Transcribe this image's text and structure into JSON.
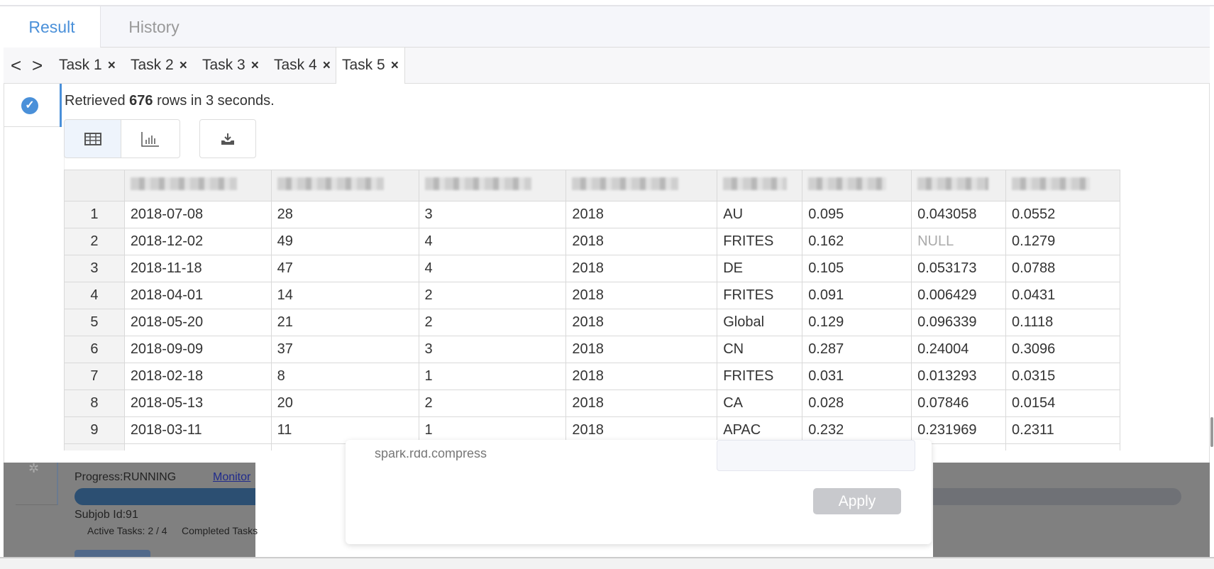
{
  "tabs": {
    "result": "Result",
    "history": "History"
  },
  "task_nav": {
    "prev": "<",
    "next": ">"
  },
  "task_tabs": [
    {
      "label": "Task 1",
      "close": "×"
    },
    {
      "label": "Task 2",
      "close": "×"
    },
    {
      "label": "Task 3",
      "close": "×"
    },
    {
      "label": "Task 4",
      "close": "×"
    },
    {
      "label": "Task 5",
      "close": "×",
      "active": true
    }
  ],
  "status": {
    "prefix": "Retrieved ",
    "count": "676",
    "suffix": " rows in 3 seconds."
  },
  "toolbar": {
    "table_icon": "table-icon",
    "chart_icon": "bar-chart-icon",
    "download_icon": "download-icon"
  },
  "table": {
    "rows": [
      [
        "1",
        "2018-07-08",
        "28",
        "3",
        "2018",
        "AU",
        "0.095",
        "0.043058",
        "0.0552"
      ],
      [
        "2",
        "2018-12-02",
        "49",
        "4",
        "2018",
        "FRITES",
        "0.162",
        "NULL",
        "0.1279"
      ],
      [
        "3",
        "2018-11-18",
        "47",
        "4",
        "2018",
        "DE",
        "0.105",
        "0.053173",
        "0.0788"
      ],
      [
        "4",
        "2018-04-01",
        "14",
        "2",
        "2018",
        "FRITES",
        "0.091",
        "0.006429",
        "0.0431"
      ],
      [
        "5",
        "2018-05-20",
        "21",
        "2",
        "2018",
        "Global",
        "0.129",
        "0.096339",
        "0.1118"
      ],
      [
        "6",
        "2018-09-09",
        "37",
        "3",
        "2018",
        "CN",
        "0.287",
        "0.24004",
        "0.3096"
      ],
      [
        "7",
        "2018-02-18",
        "8",
        "1",
        "2018",
        "FRITES",
        "0.031",
        "0.013293",
        "0.0315"
      ],
      [
        "8",
        "2018-05-13",
        "20",
        "2",
        "2018",
        "CA",
        "0.028",
        "0.07846",
        "0.0154"
      ],
      [
        "9",
        "2018-03-11",
        "11",
        "1",
        "2018",
        "APAC",
        "0.232",
        "0.231969",
        "0.2311"
      ]
    ]
  },
  "popup": {
    "text": "spark.rdd.compress",
    "apply": "Apply"
  },
  "job": {
    "progress": "Progress:RUNNING",
    "monitor": "Monitor",
    "subjob": "Subjob Id:91",
    "active": "Active Tasks: 2 / 4",
    "completed": "Completed Tasks"
  },
  "colors": {
    "accent": "#4a90d9",
    "progress": "#2c4f72"
  }
}
